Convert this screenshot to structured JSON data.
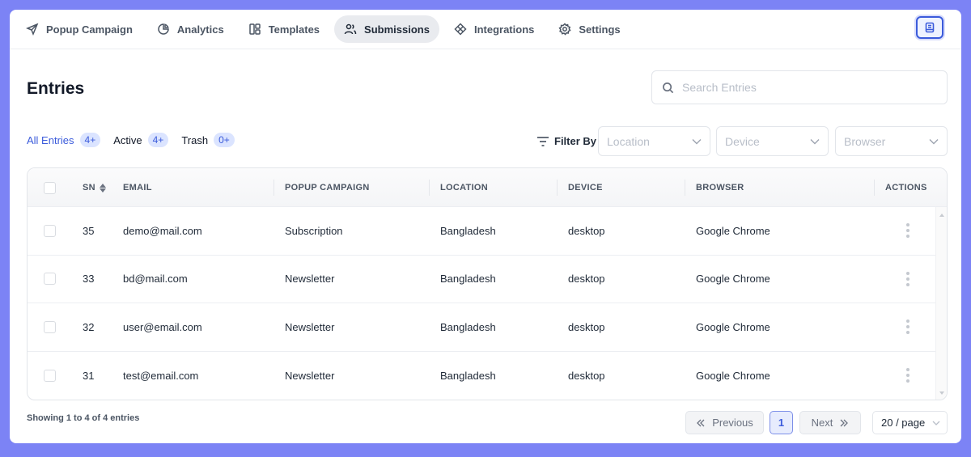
{
  "nav": {
    "tabs": [
      {
        "label": "Popup Campaign",
        "icon": "send-icon"
      },
      {
        "label": "Analytics",
        "icon": "pie-chart-icon"
      },
      {
        "label": "Templates",
        "icon": "layout-icon"
      },
      {
        "label": "Submissions",
        "icon": "users-icon",
        "active": true
      },
      {
        "label": "Integrations",
        "icon": "integrations-icon"
      },
      {
        "label": "Settings",
        "icon": "gear-icon"
      }
    ],
    "right_icon": "document-icon"
  },
  "page": {
    "title": "Entries",
    "search_placeholder": "Search Entries"
  },
  "entry_tabs": [
    {
      "label": "All Entries",
      "count": "4+",
      "active": true
    },
    {
      "label": "Active",
      "count": "4+"
    },
    {
      "label": "Trash",
      "count": "0+"
    }
  ],
  "filters": {
    "label": "Filter By",
    "location_placeholder": "Location",
    "device_placeholder": "Device",
    "browser_placeholder": "Browser"
  },
  "table": {
    "columns": {
      "sn": "SN",
      "email": "EMAIL",
      "campaign": "POPUP CAMPAIGN",
      "location": "LOCATION",
      "device": "DEVICE",
      "browser": "BROWSER",
      "actions": "ACTIONS"
    },
    "rows": [
      {
        "sn": "35",
        "email": "demo@mail.com",
        "campaign": "Subscription",
        "location": "Bangladesh",
        "device": "desktop",
        "browser": "Google Chrome"
      },
      {
        "sn": "33",
        "email": "bd@mail.com",
        "campaign": "Newsletter",
        "location": "Bangladesh",
        "device": "desktop",
        "browser": "Google Chrome"
      },
      {
        "sn": "32",
        "email": "user@email.com",
        "campaign": "Newsletter",
        "location": "Bangladesh",
        "device": "desktop",
        "browser": "Google Chrome"
      },
      {
        "sn": "31",
        "email": "test@email.com",
        "campaign": "Newsletter",
        "location": "Bangladesh",
        "device": "desktop",
        "browser": "Google Chrome"
      }
    ]
  },
  "pagination": {
    "showing": "Showing 1 to 4 of 4 entries",
    "previous": "Previous",
    "next": "Next",
    "current_page": "1",
    "per_page": "20 / page"
  },
  "colors": {
    "background": "#7c83f5",
    "accent": "#3b5bdb",
    "badge_bg": "#dbe4ff"
  }
}
